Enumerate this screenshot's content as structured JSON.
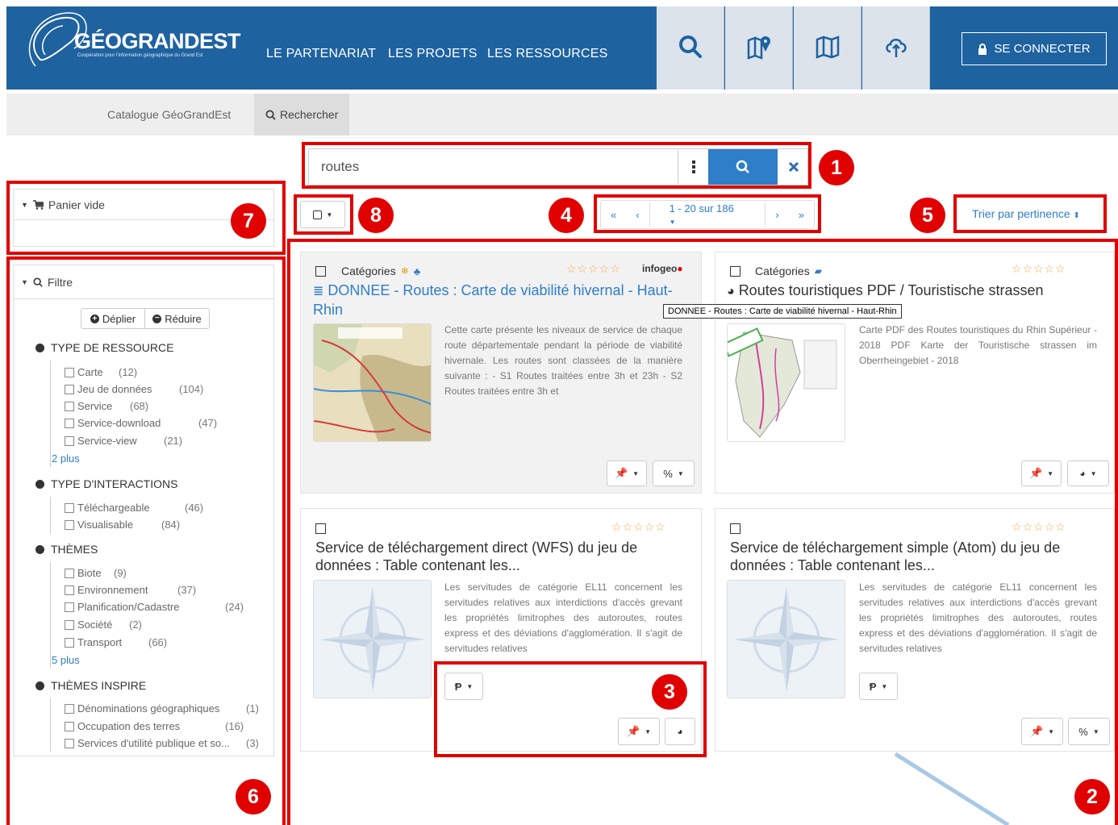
{
  "header": {
    "logo_text": "GÉOGRANDEST",
    "logo_sub": "Coopération pour l'information géographique du Grand Est",
    "nav": [
      "LE PARTENARIAT",
      "LES PROJETS",
      "LES RESSOURCES"
    ],
    "login": "SE CONNECTER"
  },
  "breadcrumb": {
    "catalogue": "Catalogue GéoGrandEst",
    "search": "Rechercher"
  },
  "search": {
    "value": "routes"
  },
  "sidebar": {
    "cart": "Panier vide",
    "filter": "Filtre",
    "expand": "Déplier",
    "collapse": "Réduire",
    "facets": [
      {
        "title": "TYPE DE RESSOURCE",
        "items": [
          {
            "label": "Carte",
            "count": "(12)"
          },
          {
            "label": "Jeu de données",
            "count": "(104)"
          },
          {
            "label": "Service",
            "count": "(68)"
          },
          {
            "label": "Service-download",
            "count": "(47)"
          },
          {
            "label": "Service-view",
            "count": "(21)"
          }
        ],
        "more": "2  plus"
      },
      {
        "title": "TYPE D'INTERACTIONS",
        "items": [
          {
            "label": "Téléchargeable",
            "count": "(46)"
          },
          {
            "label": "Visualisable",
            "count": "(84)"
          }
        ]
      },
      {
        "title": "THÈMES",
        "items": [
          {
            "label": "Biote",
            "count": "(9)"
          },
          {
            "label": "Environnement",
            "count": "(37)"
          },
          {
            "label": "Planification/Cadastre",
            "count": "(24)"
          },
          {
            "label": "Société",
            "count": "(2)"
          },
          {
            "label": "Transport",
            "count": "(66)"
          }
        ],
        "more": "5  plus"
      },
      {
        "title": "THÈMES INSPIRE",
        "items": [
          {
            "label": "Dénominations géographiques",
            "count": "(1)"
          },
          {
            "label": "Occupation des terres",
            "count": "(16)"
          },
          {
            "label": "Services d'utilité publique et so...",
            "count": "(3)"
          }
        ]
      }
    ]
  },
  "toolbar": {
    "pager": "1 - 20 sur 186",
    "sort": "Trier par pertinence"
  },
  "results": [
    {
      "categories": "Catégories",
      "title": "DONNEE - Routes : Carte de viabilité hivernal - Haut-Rhin",
      "desc": "Cette carte présente les niveaux de service de chaque route départementale pendant la période de viabilité hivernale. Les routes sont classées de la manière suivante : - S1 Routes traitées entre 3h et 23h - S2 Routes traitées entre 3h et",
      "brand": "infogeo",
      "tooltip": "DONNEE - Routes : Carte de viabilité hivernal - Haut-Rhin"
    },
    {
      "categories": "Catégories",
      "title": "Routes touristiques PDF / Touristische strassen",
      "desc": "Carte PDF des Routes touristiques du Rhin Supérieur - 2018 PDF Karte der Touristische strassen im Oberrheingebiet - 2018"
    },
    {
      "title": "Service de téléchargement direct (WFS) du jeu de données : Table contenant les...",
      "desc": "Les servitudes de catégorie EL11 concernent les servitudes relatives aux interdictions d'accès grevant les propriétés limitrophes des autoroutes, routes express et des déviations d'agglomération. Il s'agit de servitudes relatives"
    },
    {
      "title": "Service de téléchargement simple (Atom) du jeu de données : Table contenant les...",
      "desc": "Les servitudes de catégorie EL11 concernent les servitudes relatives aux interdictions d'accès grevant les propriétés limitrophes des autoroutes, routes express et des déviations d'agglomération. Il s'agit de servitudes relatives"
    }
  ],
  "annotations": [
    "1",
    "2",
    "3",
    "4",
    "5",
    "6",
    "7",
    "8"
  ],
  "colors": {
    "header_blue": "#1e62a0",
    "accent_blue": "#2e7ec9",
    "annotation_red": "#e10000",
    "star": "#f0ad4e"
  }
}
